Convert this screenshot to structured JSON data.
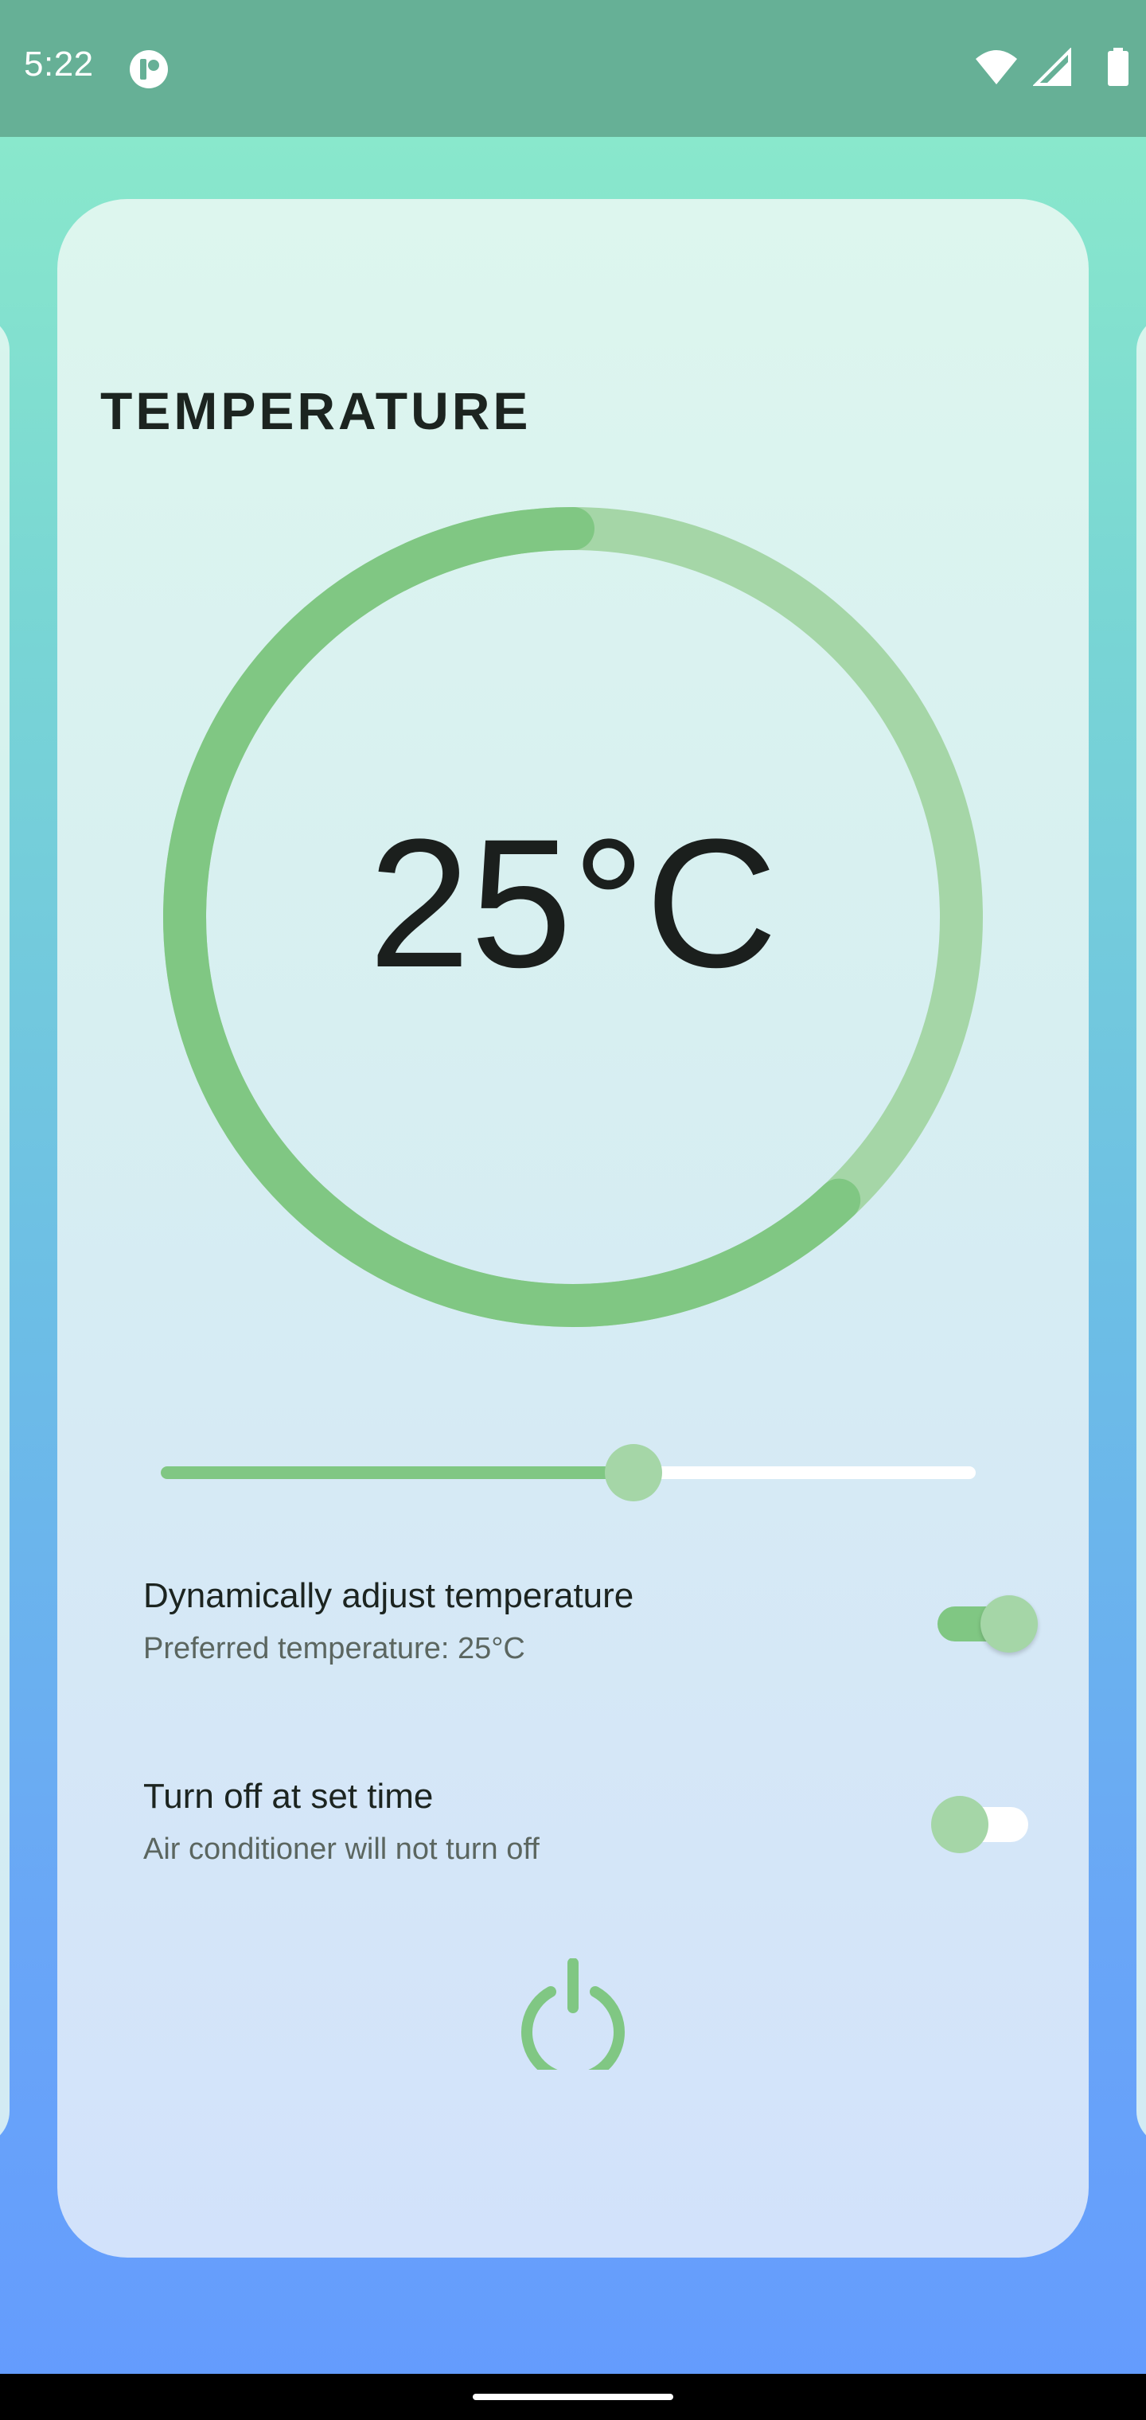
{
  "status_bar": {
    "time": "5:22",
    "icons": [
      "app-notification-icon",
      "wifi-icon",
      "cellular-signal-icon",
      "battery-icon"
    ]
  },
  "card": {
    "title": "TEMPERATURE",
    "temperature_display": "25°C",
    "dial_progress_fraction": 0.62,
    "slider_value_fraction": 0.58,
    "settings": [
      {
        "title": "Dynamically adjust temperature",
        "subtitle": "Preferred temperature: 25°C",
        "enabled": true
      },
      {
        "title": "Turn off at set time",
        "subtitle": "Air conditioner will not turn off",
        "enabled": false
      }
    ],
    "power_icon": "power-icon"
  },
  "colors": {
    "accent": "#80c783",
    "accent_light": "#a5d6a7",
    "status_bar": "#66b096"
  }
}
